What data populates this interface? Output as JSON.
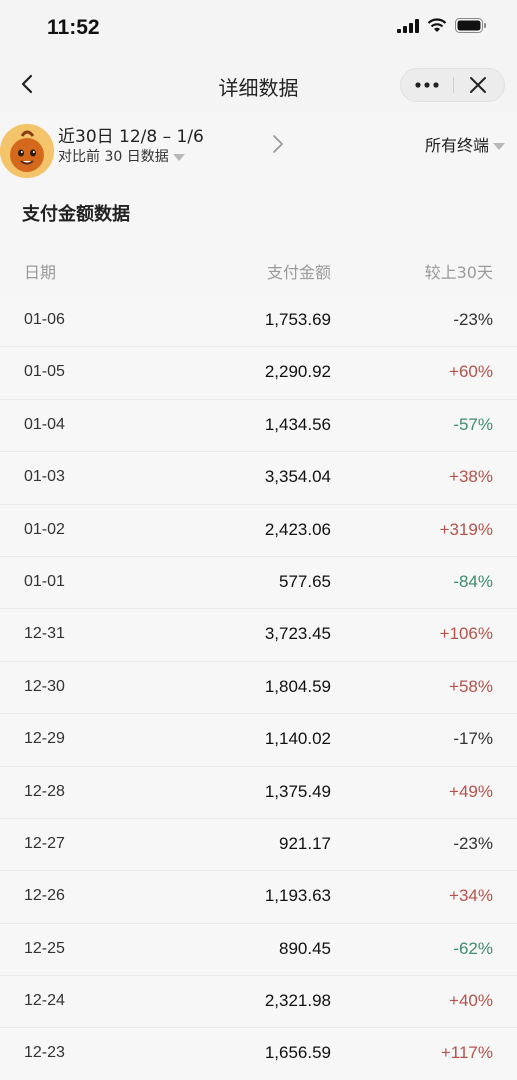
{
  "status_bar": {
    "time": "11:52"
  },
  "nav": {
    "title": "详细数据"
  },
  "filter": {
    "date_range": "近30日 12/8 – 1/6",
    "compare": "对比前 30 日数据",
    "terminal": "所有终端"
  },
  "section": {
    "title": "支付金额数据"
  },
  "table": {
    "headers": {
      "date": "日期",
      "amount": "支付金额",
      "change": "较上30天"
    },
    "rows": [
      {
        "date": "01-06",
        "amount": "1,753.69",
        "change": "-23%",
        "color": "#333333"
      },
      {
        "date": "01-05",
        "amount": "2,290.92",
        "change": "+60%",
        "color": "#b5534a"
      },
      {
        "date": "01-04",
        "amount": "1,434.56",
        "change": "-57%",
        "color": "#3e8c6e"
      },
      {
        "date": "01-03",
        "amount": "3,354.04",
        "change": "+38%",
        "color": "#b5534a"
      },
      {
        "date": "01-02",
        "amount": "2,423.06",
        "change": "+319%",
        "color": "#b5534a"
      },
      {
        "date": "01-01",
        "amount": "577.65",
        "change": "-84%",
        "color": "#3e8c6e"
      },
      {
        "date": "12-31",
        "amount": "3,723.45",
        "change": "+106%",
        "color": "#b5534a"
      },
      {
        "date": "12-30",
        "amount": "1,804.59",
        "change": "+58%",
        "color": "#b5534a"
      },
      {
        "date": "12-29",
        "amount": "1,140.02",
        "change": "-17%",
        "color": "#333333"
      },
      {
        "date": "12-28",
        "amount": "1,375.49",
        "change": "+49%",
        "color": "#b5534a"
      },
      {
        "date": "12-27",
        "amount": "921.17",
        "change": "-23%",
        "color": "#333333"
      },
      {
        "date": "12-26",
        "amount": "1,193.63",
        "change": "+34%",
        "color": "#b5534a"
      },
      {
        "date": "12-25",
        "amount": "890.45",
        "change": "-62%",
        "color": "#3e8c6e"
      },
      {
        "date": "12-24",
        "amount": "2,321.98",
        "change": "+40%",
        "color": "#b5534a"
      },
      {
        "date": "12-23",
        "amount": "1,656.59",
        "change": "+117%",
        "color": "#b5534a"
      }
    ]
  },
  "icons": {
    "back": "chevron-left-icon",
    "more": "more-dots-icon",
    "close": "close-icon",
    "next": "chevron-right-icon",
    "dropdown": "caret-down-icon"
  }
}
